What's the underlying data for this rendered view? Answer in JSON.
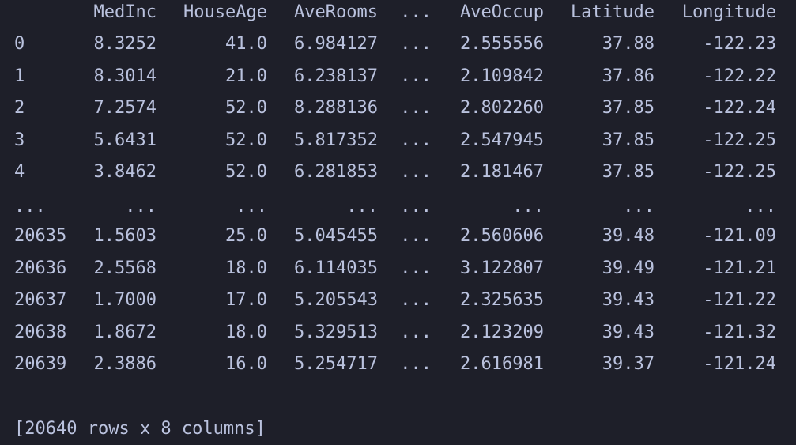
{
  "table": {
    "header": [
      "MedInc",
      "HouseAge",
      "AveRooms",
      "...",
      "AveOccup",
      "Latitude",
      "Longitude"
    ],
    "rows": [
      {
        "index": "0",
        "cells": [
          "8.3252",
          "41.0",
          "6.984127",
          "...",
          "2.555556",
          "37.88",
          "-122.23"
        ]
      },
      {
        "index": "1",
        "cells": [
          "8.3014",
          "21.0",
          "6.238137",
          "...",
          "2.109842",
          "37.86",
          "-122.22"
        ]
      },
      {
        "index": "2",
        "cells": [
          "7.2574",
          "52.0",
          "8.288136",
          "...",
          "2.802260",
          "37.85",
          "-122.24"
        ]
      },
      {
        "index": "3",
        "cells": [
          "5.6431",
          "52.0",
          "5.817352",
          "...",
          "2.547945",
          "37.85",
          "-122.25"
        ]
      },
      {
        "index": "4",
        "cells": [
          "3.8462",
          "52.0",
          "6.281853",
          "...",
          "2.181467",
          "37.85",
          "-122.25"
        ]
      },
      {
        "index": "...",
        "cells": [
          "...",
          "...",
          "...",
          "...",
          "...",
          "...",
          "..."
        ]
      },
      {
        "index": "20635",
        "cells": [
          "1.5603",
          "25.0",
          "5.045455",
          "...",
          "2.560606",
          "39.48",
          "-121.09"
        ]
      },
      {
        "index": "20636",
        "cells": [
          "2.5568",
          "18.0",
          "6.114035",
          "...",
          "3.122807",
          "39.49",
          "-121.21"
        ]
      },
      {
        "index": "20637",
        "cells": [
          "1.7000",
          "17.0",
          "5.205543",
          "...",
          "2.325635",
          "39.43",
          "-121.22"
        ]
      },
      {
        "index": "20638",
        "cells": [
          "1.8672",
          "18.0",
          "5.329513",
          "...",
          "2.123209",
          "39.43",
          "-121.32"
        ]
      },
      {
        "index": "20639",
        "cells": [
          "2.3886",
          "16.0",
          "5.254717",
          "...",
          "2.616981",
          "39.37",
          "-121.24"
        ]
      }
    ],
    "summary": "[20640 rows x 8 columns]"
  },
  "colors": {
    "background": "#1e1f29",
    "text": "#bac2de"
  }
}
